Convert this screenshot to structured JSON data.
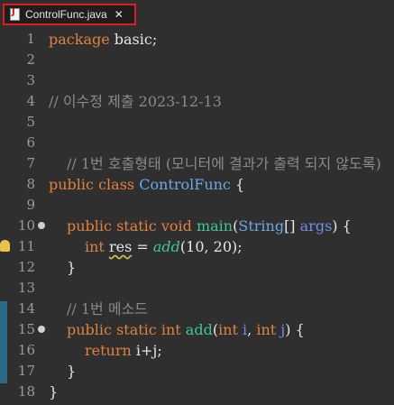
{
  "tab": {
    "label": "ControlFunc.java",
    "close_glyph": "✕",
    "icon": "java-file-icon"
  },
  "lines": [
    {
      "num": "1"
    },
    {
      "num": "2"
    },
    {
      "num": "3"
    },
    {
      "num": "4"
    },
    {
      "num": "5"
    },
    {
      "num": "6"
    },
    {
      "num": "7"
    },
    {
      "num": "8"
    },
    {
      "num": "9"
    },
    {
      "num": "10"
    },
    {
      "num": "11"
    },
    {
      "num": "12"
    },
    {
      "num": "13"
    },
    {
      "num": "14"
    },
    {
      "num": "15"
    },
    {
      "num": "16"
    },
    {
      "num": "17"
    },
    {
      "num": "18"
    }
  ],
  "code": {
    "l1": {
      "kw": "package",
      "rest": " basic;"
    },
    "l4": {
      "comment": "// 이수정 제출 2023-12-13"
    },
    "l7": {
      "comment": "// 1번 호출형태 (모니터에 결과가 출력 되지 않도록)"
    },
    "l8": {
      "kw": "public class",
      "cls": "ControlFunc",
      "rest": " {"
    },
    "l10": {
      "kw": "public static void",
      "mth": "main",
      "p1": "(",
      "type": "String",
      "p2": "[] ",
      "var": "args",
      "p3": ") {"
    },
    "l11": {
      "kw": "int",
      "var": "res",
      "eq": " = ",
      "call": "add",
      "args": "(10, 20);"
    },
    "l12": {
      "text": "}"
    },
    "l14": {
      "comment": "// 1번 메소드"
    },
    "l15": {
      "kw": "public static int",
      "mth": "add",
      "p1": "(",
      "kw2": "int",
      "var1": "i",
      "comma": ", ",
      "kw3": "int",
      "var2": "j",
      "p2": ") {"
    },
    "l16": {
      "kw": "return",
      "rest": " i+j;"
    },
    "l17": {
      "text": "}"
    },
    "l18": {
      "text": "}"
    }
  },
  "colors": {
    "keyword": "#e1813e",
    "comment": "#8a8a8a",
    "class": "#6aa9e6",
    "method": "#3fc78f",
    "variable": "#6f8fe6",
    "highlight_border": "#e31b23"
  }
}
